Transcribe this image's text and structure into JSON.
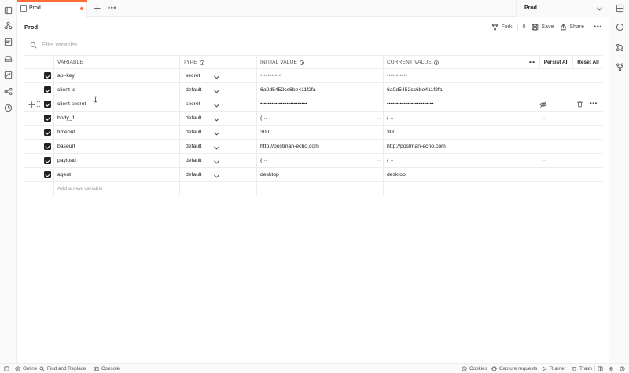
{
  "tab": {
    "label": "Prod"
  },
  "environment_selector": {
    "label": "Prod"
  },
  "header": {
    "title": "Prod",
    "fork_label": "Fork",
    "fork_count": "0",
    "save_label": "Save",
    "share_label": "Share"
  },
  "filter": {
    "placeholder": "Filter variables"
  },
  "table": {
    "columns": {
      "variable": "VARIABLE",
      "type": "TYPE",
      "initial": "INITIAL VALUE",
      "current": "CURRENT VALUE"
    },
    "persist_all": "Persist All",
    "reset_all": "Reset All",
    "rows": [
      {
        "name": "api-key",
        "type": "secret",
        "initial": "•••••••••••",
        "current": "•••••••••••"
      },
      {
        "name": "client id",
        "type": "default",
        "initial": "6a0d5452cc6be411f2fa",
        "current": "6a0d5452cc6be411f2fa"
      },
      {
        "name": "client secret",
        "type": "secret",
        "initial": "•••••••••••••••••••••••••",
        "current": "•••••••••••••••••••••••••"
      },
      {
        "name": "body_1",
        "type": "default",
        "initial": "{ ··",
        "current": "{ ··"
      },
      {
        "name": "timeout",
        "type": "default",
        "initial": "300",
        "current": "300"
      },
      {
        "name": "baseurl",
        "type": "default",
        "initial": "http://postman-echo.com",
        "current": "http://postman-echo.com"
      },
      {
        "name": "payload",
        "type": "default",
        "initial": "{ ··",
        "current": "{ ··"
      },
      {
        "name": "agent",
        "type": "default",
        "initial": "desktop",
        "current": "desktop"
      }
    ],
    "add_placeholder": "Add a new variable"
  },
  "statusbar": {
    "online": "Online",
    "find_replace": "Find and Replace",
    "console": "Console",
    "cookies": "Cookies",
    "capture": "Capture requests",
    "runner": "Runner",
    "trash": "Trash"
  },
  "colors": {
    "accent": "#ff6c37",
    "border": "#ededed",
    "text": "#212121",
    "muted": "#a0a0a0"
  }
}
